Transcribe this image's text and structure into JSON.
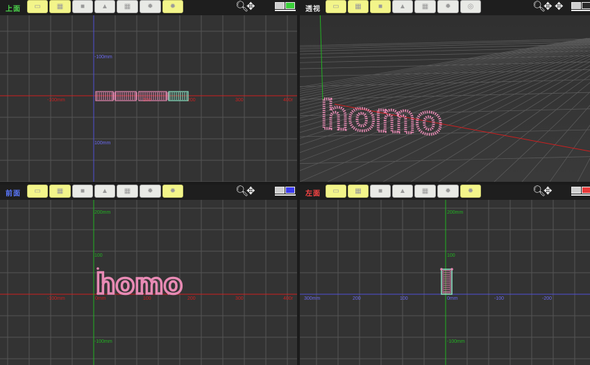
{
  "colors": {
    "viewport_bg": "#333333",
    "grid": "#555555",
    "x_axis": "#cc1f1f",
    "y_axis_green": "#22b322",
    "z_axis_blue": "#4f4fd6",
    "text_mesh": "#e88ab4",
    "text_mesh_selected": "#8de8c8",
    "toolbar_button": "#f3f58a"
  },
  "viewports": {
    "top": {
      "title": "上面",
      "title_color": "#4bd34b",
      "x_labels": [
        "-100mm",
        "100",
        "200",
        "300",
        "400r"
      ],
      "y_labels": [
        "-100mm",
        "100mm"
      ]
    },
    "perspective": {
      "title": "透视",
      "title_color": "#e8e8e8",
      "model_text": "homo"
    },
    "front": {
      "title": "前面",
      "title_color": "#5a78ff",
      "x_labels": [
        "-100mm",
        "0mm",
        "100",
        "200",
        "300",
        "400r"
      ],
      "y_labels": [
        "200mm",
        "100",
        "-100mm"
      ],
      "model_text": "homo"
    },
    "left": {
      "title": "左面",
      "title_color": "#ff4545",
      "x_labels": [
        "300mm",
        "200",
        "100",
        "0mm",
        "-100",
        "-200"
      ],
      "y_labels": [
        "200mm",
        "100",
        "-100mm"
      ]
    }
  },
  "toolbar_icons": [
    "fit-view-icon",
    "frame-icon",
    "cube-icon",
    "cylinder-icon",
    "grid-icon",
    "gear-icon",
    "refresh-icon"
  ],
  "nav_icons": [
    "zoom-icon",
    "pan-icon",
    "orbit-icon",
    "monitor-icon"
  ]
}
